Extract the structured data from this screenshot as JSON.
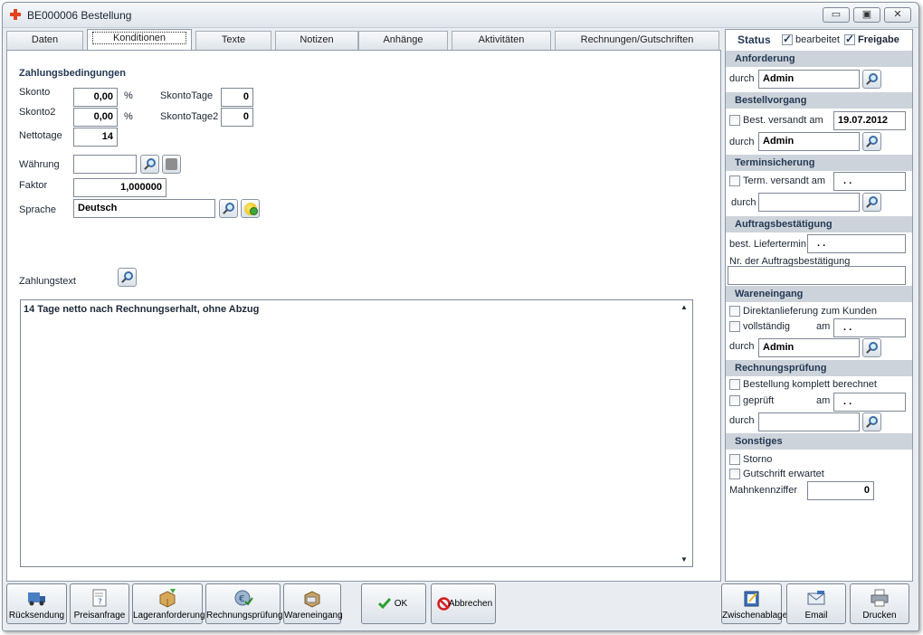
{
  "window": {
    "title": "BE000006 Bestellung",
    "minimize": "▭",
    "maximize": "▣",
    "close": "✕"
  },
  "tabs": [
    "Daten",
    "Konditionen",
    "Texte",
    "Notizen",
    "Anhänge",
    "Aktivitäten",
    "Rechnungen/Gutschriften"
  ],
  "active_tab": "Konditionen",
  "payment": {
    "heading": "Zahlungsbedingungen",
    "skonto_label": "Skonto",
    "skonto_value": "0,00",
    "skonto_unit": "%",
    "skontotage_label": "SkontoTage",
    "skontotage_value": "0",
    "skonto2_label": "Skonto2",
    "skonto2_value": "0,00",
    "skonto2_unit": "%",
    "skontotage2_label": "SkontoTage2",
    "skontotage2_value": "0",
    "nettotage_label": "Nettotage",
    "nettotage_value": "14",
    "waehrung_label": "Währung",
    "waehrung_value": "",
    "faktor_label": "Faktor",
    "faktor_value": "1,000000",
    "sprache_label": "Sprache",
    "sprache_value": "Deutsch",
    "zahlungstext_label": "Zahlungstext",
    "zahlungstext_value": "14 Tage netto nach Rechnungserhalt, ohne Abzug"
  },
  "status": {
    "label": "Status",
    "bearbeitet_label": "bearbeitet",
    "bearbeitet_checked": true,
    "freigabe_label": "Freigabe",
    "freigabe_checked": true,
    "anforderung": {
      "title": "Anforderung",
      "durch_label": "durch",
      "durch_value": "Admin"
    },
    "bestellvorgang": {
      "title": "Bestellvorgang",
      "versandt_label": "Best. versandt am",
      "versandt_date": "19.07.2012",
      "durch_label": "durch",
      "durch_value": "Admin"
    },
    "terminsicherung": {
      "title": "Terminsicherung",
      "versandt_label": "Term. versandt am",
      "versandt_date": ". .",
      "durch_label": "durch",
      "durch_value": ""
    },
    "auftragsbestaetigung": {
      "title": "Auftragsbestätigung",
      "liefertermin_label": "best. Liefertermin",
      "liefertermin_value": ". .",
      "nr_label": "Nr. der Auftragsbestätigung",
      "nr_value": ""
    },
    "wareneingang": {
      "title": "Wareneingang",
      "direkt_label": "Direktanlieferung zum Kunden",
      "vollstaendig_label": "vollständig",
      "am_label": "am",
      "am_value": ". .",
      "durch_label": "durch",
      "durch_value": "Admin"
    },
    "rechnungspruefung": {
      "title": "Rechnungsprüfung",
      "komplett_label": "Bestellung komplett berechnet",
      "geprueft_label": "geprüft",
      "am_label": "am",
      "am_value": ". .",
      "durch_label": "durch",
      "durch_value": ""
    },
    "sonstiges": {
      "title": "Sonstiges",
      "storno_label": "Storno",
      "gutschrift_label": "Gutschrift erwartet",
      "mahn_label": "Mahnkennziffer",
      "mahn_value": "0"
    }
  },
  "toolbar": {
    "ruecksendung": "Rücksendung",
    "preisanfrage": "Preisanfrage",
    "lageranforderung": "Lageranforderung",
    "rechnungspruefung": "Rechnungsprüfung",
    "wareneingang": "Wareneingang",
    "ok": "OK",
    "abbrechen": "Abbrechen",
    "zwischenablage": "Zwischenablage",
    "email": "Email",
    "drucken": "Drucken"
  },
  "scroll": {
    "up": "▲",
    "down": "▼"
  }
}
